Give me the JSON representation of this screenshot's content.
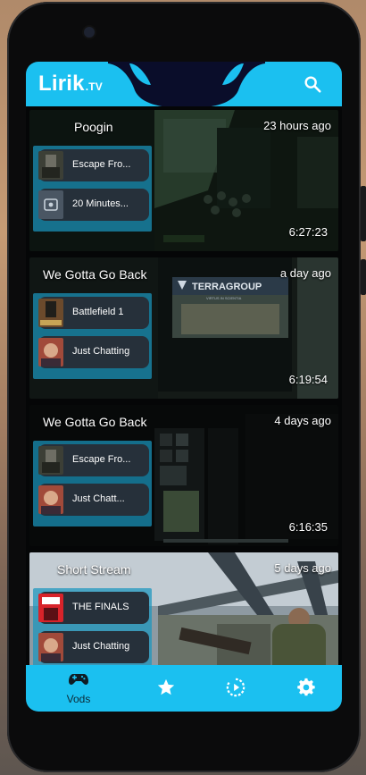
{
  "app": {
    "name": "Lirik",
    "suffix": ".TV"
  },
  "vods": [
    {
      "title": "Poogin",
      "date": "23 hours ago",
      "duration": "6:27:23",
      "chapters": [
        {
          "label": "Escape Fro...",
          "art": "tarkov"
        },
        {
          "label": "20 Minutes...",
          "art": "placeholder"
        }
      ]
    },
    {
      "title": "We Gotta Go Back",
      "date": "a day ago",
      "duration": "6:19:54",
      "chapters": [
        {
          "label": "Battlefield 1",
          "art": "battlefield"
        },
        {
          "label": "Just Chatting",
          "art": "chatting"
        }
      ]
    },
    {
      "title": "We Gotta Go Back",
      "date": "4 days ago",
      "duration": "6:16:35",
      "chapters": [
        {
          "label": "Escape Fro...",
          "art": "tarkov"
        },
        {
          "label": "Just Chatt...",
          "art": "chatting"
        }
      ]
    },
    {
      "title": "Short Stream",
      "date": "5 days ago",
      "duration": "",
      "chapters": [
        {
          "label": "THE FINALS",
          "art": "finals"
        },
        {
          "label": "Just Chatting",
          "art": "chatting"
        }
      ]
    }
  ],
  "thumb_texts": {
    "terragroup": "TERRAGROUP",
    "scientia": "VIRTUS IN SCIENTIA"
  },
  "nav": [
    {
      "label": "Vods",
      "icon": "gamepad-icon",
      "active": true
    },
    {
      "label": "",
      "icon": "star-icon",
      "active": false
    },
    {
      "label": "",
      "icon": "live-play-icon",
      "active": false
    },
    {
      "label": "",
      "icon": "gear-icon",
      "active": false
    }
  ],
  "colors": {
    "accent": "#1bc0f0",
    "chip": "#26303a",
    "chapter_panel": "#1b96be"
  }
}
